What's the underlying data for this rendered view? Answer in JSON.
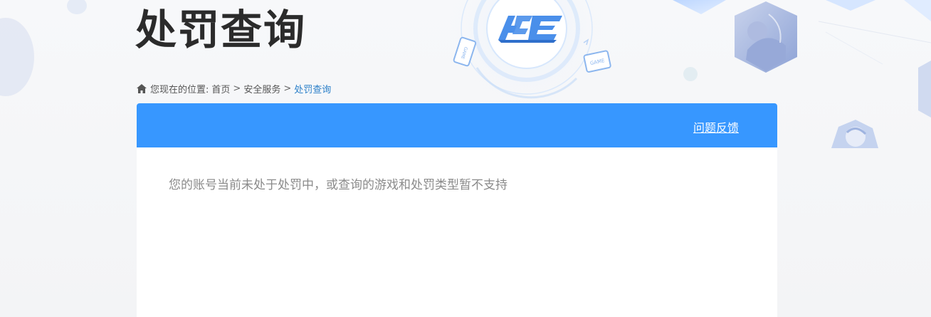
{
  "page": {
    "title": "处罚查询"
  },
  "logo": {
    "text": "ACE",
    "badges": [
      "GAME",
      "GAME"
    ]
  },
  "breadcrumb": {
    "prefix": "您现在的位置:",
    "items": [
      "首页",
      "安全服务",
      "处罚查询"
    ],
    "separator": ">"
  },
  "panel": {
    "feedback_label": "问题反馈",
    "message": "您的账号当前未处于处罚中，或查询的游戏和处罚类型暂不支持"
  },
  "colors": {
    "header_blue": "#3797ff",
    "breadcrumb_current": "#2a7fc9",
    "title": "#2b2b2b"
  }
}
